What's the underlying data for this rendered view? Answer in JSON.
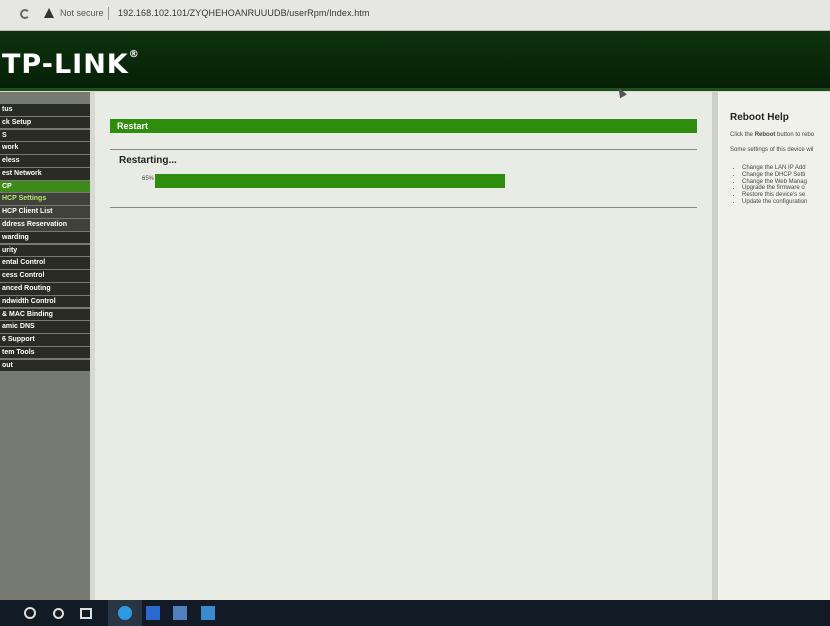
{
  "browser": {
    "security_label": "Not secure",
    "url": "192.168.102.101/ZYQHEHOANRUUUDB/userRpm/Index.htm"
  },
  "header": {
    "logo": "TP-LINK",
    "logo_mark": "®"
  },
  "sidebar": {
    "items": [
      {
        "label": "tus"
      },
      {
        "label": "ck Setup"
      },
      {
        "label": "S"
      },
      {
        "label": "work"
      },
      {
        "label": "eless"
      },
      {
        "label": "est Network"
      },
      {
        "label": "CP"
      },
      {
        "label": "HCP Settings"
      },
      {
        "label": "HCP Client List"
      },
      {
        "label": "ddress Reservation"
      },
      {
        "label": "warding"
      },
      {
        "label": "urity"
      },
      {
        "label": "ental Control"
      },
      {
        "label": "cess Control"
      },
      {
        "label": "anced Routing"
      },
      {
        "label": "ndwidth Control"
      },
      {
        "label": "& MAC Binding"
      },
      {
        "label": "amic DNS"
      },
      {
        "label": "6 Support"
      },
      {
        "label": "tem Tools"
      },
      {
        "label": "out"
      }
    ]
  },
  "main": {
    "title": "Restart",
    "status": "Restarting...",
    "progress_label": "65%",
    "progress_value": 0.65
  },
  "help": {
    "title": "Reboot Help",
    "p1_prefix": "Click the ",
    "p1_bold": "Reboot",
    "p1_suffix": " button to rebo",
    "p2": "Some settings of this device wil",
    "list": [
      "Change the LAN IP Add",
      "Change the DHCP Setti",
      "Change the Web Manag",
      "Upgrade the firmware o",
      "Restore this device's se",
      "Update the configuration"
    ]
  },
  "colors": {
    "accent": "#2f8d0e",
    "header": "#0a2a0a",
    "sidebar_item": "#2a2b25",
    "sidebar_active": "#3d8a1a"
  }
}
